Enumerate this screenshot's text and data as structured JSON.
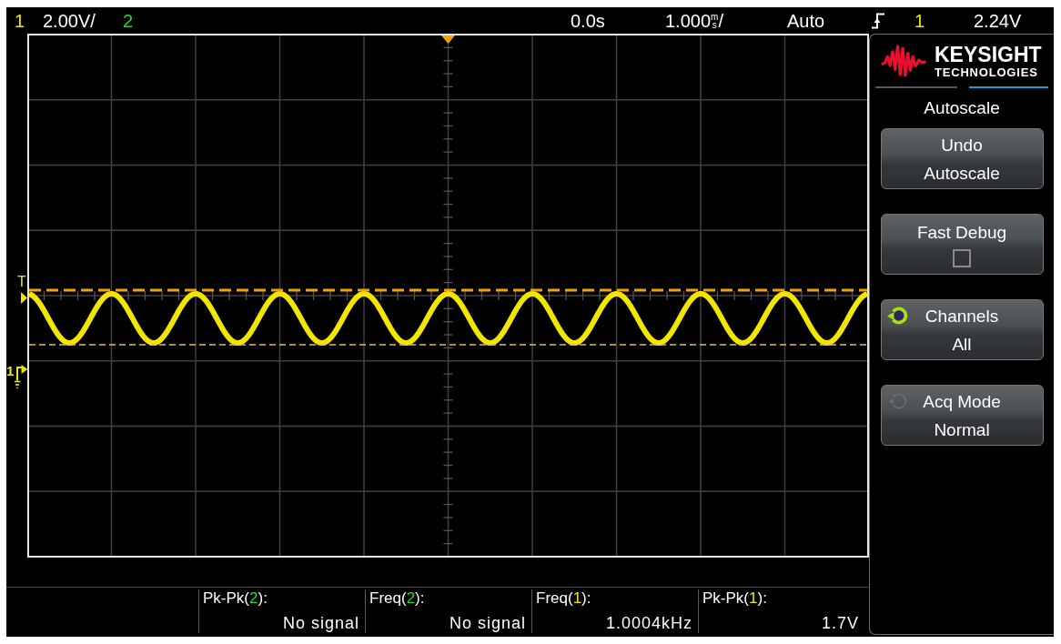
{
  "top_bar": {
    "channels": [
      {
        "number": "1",
        "color": "#f2e600",
        "scale": "2.00V/"
      },
      {
        "number": "2",
        "color": "#22dd22"
      }
    ],
    "time_position": "0.0s",
    "timebase": {
      "scale": "1.000",
      "unit": "ms",
      "per": "/"
    },
    "trigger": {
      "mode": "Auto",
      "source": "1",
      "color": "#f2e600",
      "voltage": "2.24V"
    }
  },
  "display": {
    "trigger_marker": "T",
    "ground_marker": "1"
  },
  "brand": {
    "name": "KEYSIGHT",
    "subtitle": "TECHNOLOGIES"
  },
  "menu": {
    "title": "Autoscale",
    "softkeys": [
      {
        "kind": "action",
        "label": "Undo",
        "value": "Autoscale"
      },
      {
        "kind": "toggle",
        "label": "Fast Debug",
        "checked": false
      },
      {
        "kind": "select",
        "label": "Channels",
        "value": "All",
        "knob_active": true
      },
      {
        "kind": "select",
        "label": "Acq Mode",
        "value": "Normal",
        "knob_active": false
      }
    ]
  },
  "measurements": [
    {
      "prefix": "Pk-Pk(",
      "channel": "2",
      "suffix": "):",
      "color": "#22dd22",
      "value": "No signal"
    },
    {
      "prefix": "Freq(",
      "channel": "2",
      "suffix": "):",
      "color": "#22dd22",
      "value": "No signal"
    },
    {
      "prefix": "Freq(",
      "channel": "1",
      "suffix": "):",
      "color": "#f2e600",
      "value": "1.0004kHz"
    },
    {
      "prefix": "Pk-Pk(",
      "channel": "1",
      "suffix": "):",
      "color": "#f2e600",
      "value": "1.7V"
    }
  ]
}
